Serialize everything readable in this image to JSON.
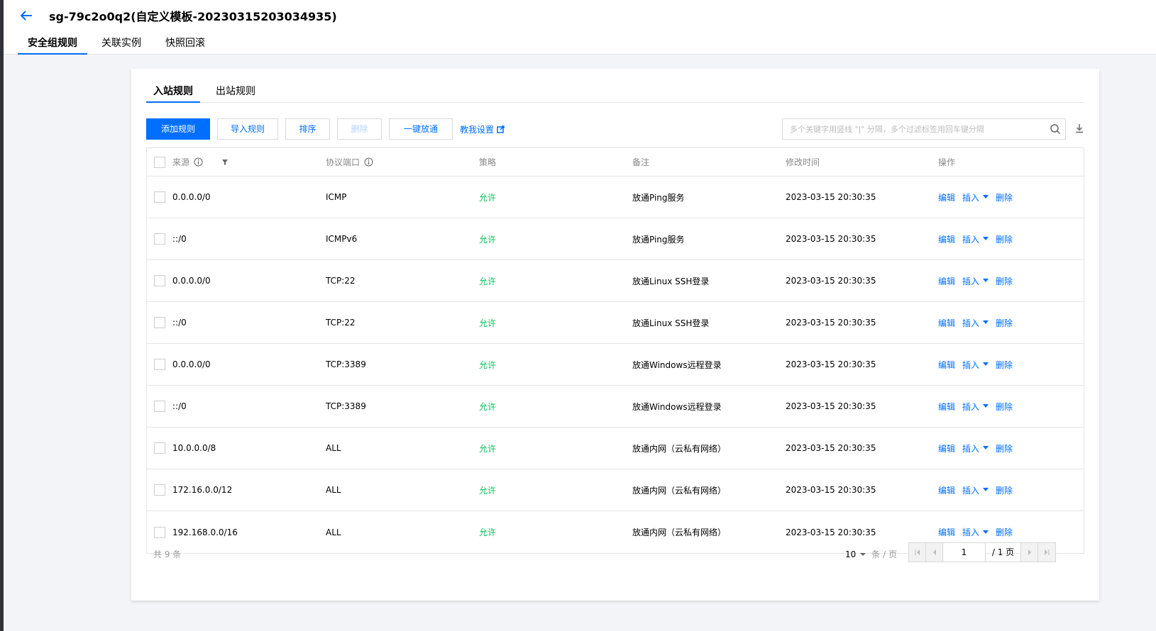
{
  "header": {
    "title": "sg-79c2o0q2(自定义模板-20230315203034935)",
    "tabs": [
      {
        "label": "安全组规则"
      },
      {
        "label": "关联实例"
      },
      {
        "label": "快照回滚"
      }
    ]
  },
  "rule_tabs": [
    {
      "label": "入站规则"
    },
    {
      "label": "出站规则"
    }
  ],
  "toolbar": {
    "add_label": "添加规则",
    "import_label": "导入规则",
    "sort_label": "排序",
    "delete_label": "删除",
    "open_all_label": "一键放通",
    "tutorial_label": "教我设置",
    "search_placeholder": "多个关键字用竖线 \"|\" 分隔，多个过滤标签用回车键分隔"
  },
  "table": {
    "columns": {
      "source": "来源",
      "protocol": "协议端口",
      "policy": "策略",
      "remark": "备注",
      "time": "修改时间",
      "ops": "操作"
    },
    "op_labels": {
      "edit": "编辑",
      "insert": "插入",
      "delete": "删除"
    },
    "rows": [
      {
        "source": "0.0.0.0/0",
        "protocol": "ICMP",
        "policy": "允许",
        "remark": "放通Ping服务",
        "time": "2023-03-15 20:30:35"
      },
      {
        "source": "::/0",
        "protocol": "ICMPv6",
        "policy": "允许",
        "remark": "放通Ping服务",
        "time": "2023-03-15 20:30:35"
      },
      {
        "source": "0.0.0.0/0",
        "protocol": "TCP:22",
        "policy": "允许",
        "remark": "放通Linux SSH登录",
        "time": "2023-03-15 20:30:35"
      },
      {
        "source": "::/0",
        "protocol": "TCP:22",
        "policy": "允许",
        "remark": "放通Linux SSH登录",
        "time": "2023-03-15 20:30:35"
      },
      {
        "source": "0.0.0.0/0",
        "protocol": "TCP:3389",
        "policy": "允许",
        "remark": "放通Windows远程登录",
        "time": "2023-03-15 20:30:35"
      },
      {
        "source": "::/0",
        "protocol": "TCP:3389",
        "policy": "允许",
        "remark": "放通Windows远程登录",
        "time": "2023-03-15 20:30:35"
      },
      {
        "source": "10.0.0.0/8",
        "protocol": "ALL",
        "policy": "允许",
        "remark": "放通内网（云私有网络）",
        "time": "2023-03-15 20:30:35"
      },
      {
        "source": "172.16.0.0/12",
        "protocol": "ALL",
        "policy": "允许",
        "remark": "放通内网（云私有网络）",
        "time": "2023-03-15 20:30:35"
      },
      {
        "source": "192.168.0.0/16",
        "protocol": "ALL",
        "policy": "允许",
        "remark": "放通内网（云私有网络）",
        "time": "2023-03-15 20:30:35"
      }
    ]
  },
  "footer": {
    "total_text": "共 9 条",
    "page_size": "10",
    "page_size_unit": "条 / 页",
    "current_page": "1",
    "total_pages_text": "/ 1 页"
  },
  "colors": {
    "accent": "#006eff",
    "allow": "#0abf5b"
  }
}
